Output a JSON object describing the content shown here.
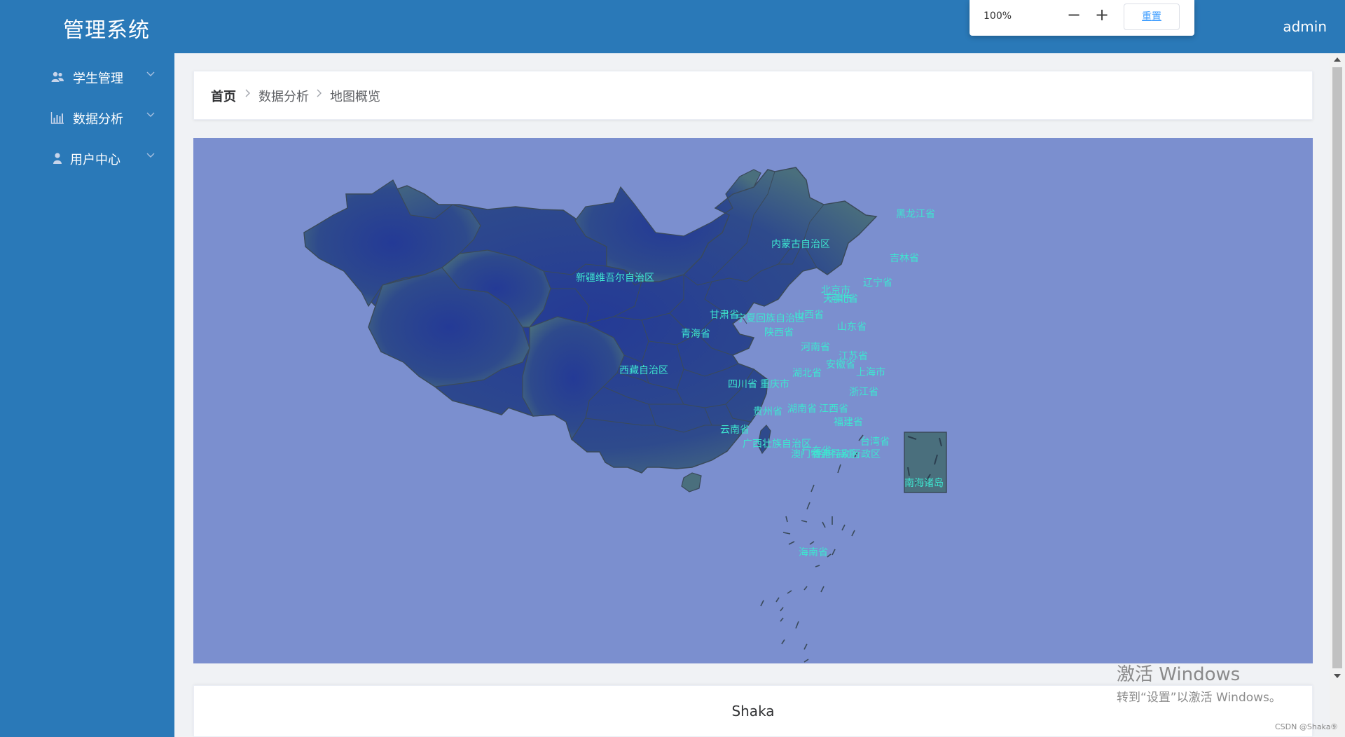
{
  "header": {
    "app_title": "管理系统",
    "user_name": "admin"
  },
  "zoom": {
    "value": "100%",
    "zoom_out_label": "−",
    "zoom_in_label": "+",
    "reset_label": "重置"
  },
  "sidebar": {
    "items": [
      {
        "label": "学生管理",
        "icon": "users-icon"
      },
      {
        "label": "数据分析",
        "icon": "bar-chart-icon"
      },
      {
        "label": "用户中心",
        "icon": "user-icon"
      }
    ]
  },
  "breadcrumb": {
    "items": [
      "首页",
      "数据分析",
      "地图概览"
    ]
  },
  "map": {
    "background_color": "#7b8fcf",
    "region_fill": "#2c3f8f",
    "label_color": "#3ee6d0",
    "labels": {
      "heilongjiang": "黑龙江省",
      "neimenggu": "内蒙古自治区",
      "jilin": "吉林省",
      "liaoning": "辽宁省",
      "xinjiang": "新疆维吾尔自治区",
      "beijing": "北京市",
      "tianjin": "天津市",
      "hebei": "河北省",
      "gansu": "甘肃省",
      "ningxia": "宁夏回族自治区",
      "shanxi": "山西省",
      "shandong": "山东省",
      "qinghai": "青海省",
      "shaanxi": "陕西省",
      "henan": "河南省",
      "jiangsu": "江苏省",
      "anhui": "安徽省",
      "xizang": "西藏自治区",
      "hubei": "湖北省",
      "shanghai": "上海市",
      "sichuan": "四川省",
      "chongqing": "重庆市",
      "zhejiang": "浙江省",
      "guizhou": "贵州省",
      "hunan": "湖南省",
      "jiangxi": "江西省",
      "fujian": "福建省",
      "yunnan": "云南省",
      "guangxi": "广西壮族自治区",
      "taiwan": "台湾省",
      "guangdong": "广东省",
      "hongkong": "香港特别行政区",
      "macau": "澳门特别行政区",
      "nanhai": "南海诸岛",
      "hainan": "海南省"
    }
  },
  "footer": {
    "text": "Shaka"
  },
  "watermark": {
    "title": "激活 Windows",
    "subtitle": "转到“设置”以激活 Windows。"
  },
  "csdn": "CSDN @Shaka⑨"
}
